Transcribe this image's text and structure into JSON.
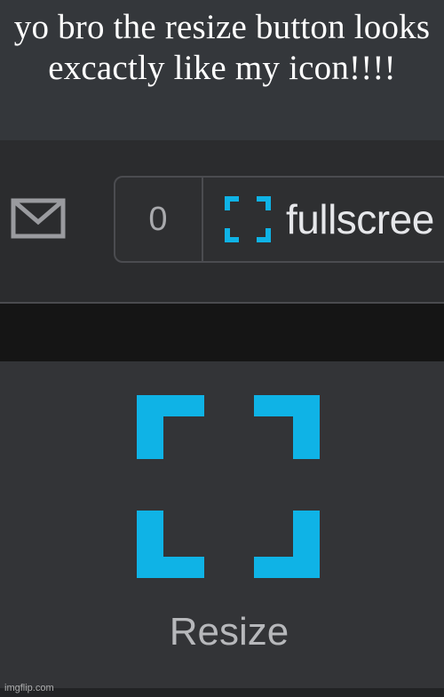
{
  "caption": {
    "text": "yo bro the resize button looks excactly like my icon!!!!"
  },
  "toolbar": {
    "mail_icon": "envelope-icon",
    "notification_count": "0",
    "fullscreen_icon": "fullscreen-corners-icon",
    "fullscreen_label": "fullscree"
  },
  "resize_panel": {
    "icon": "resize-corners-icon",
    "label": "Resize"
  },
  "watermark": "imgflip.com",
  "colors": {
    "accent_cyan": "#0fb3e6",
    "panel_dark": "#333437",
    "caption_bg": "#34373b",
    "strip_black": "#151515"
  }
}
